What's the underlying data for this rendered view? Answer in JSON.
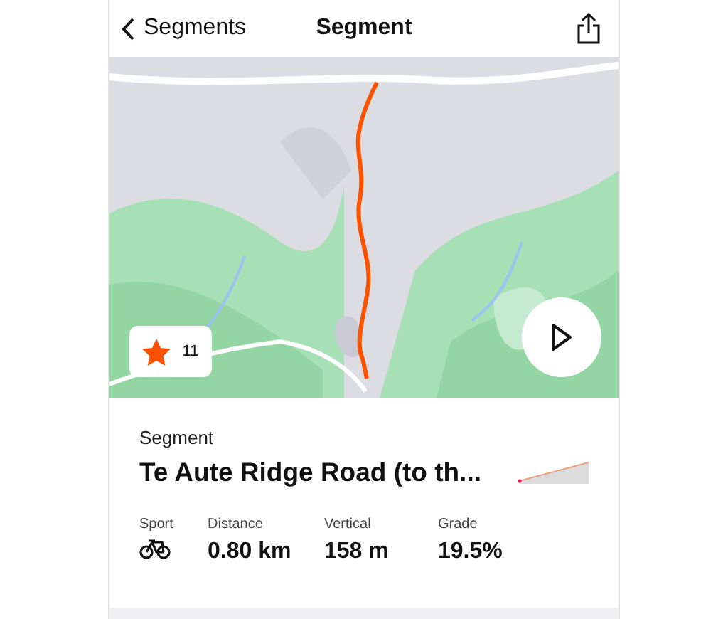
{
  "nav": {
    "back_label": "Segments",
    "title": "Segment"
  },
  "map": {
    "kind": "picture",
    "star_count": "11"
  },
  "segment": {
    "caption": "Segment",
    "name": "Te Aute Ridge Road (to th...",
    "stats": [
      {
        "label": "Sport",
        "kind": "icon"
      },
      {
        "label": "Distance",
        "kind": "text",
        "value": "0.80 km"
      },
      {
        "label": "Vertical",
        "kind": "text",
        "value": "158 m"
      },
      {
        "label": "Grade",
        "kind": "text",
        "value": "19.5%"
      }
    ]
  }
}
